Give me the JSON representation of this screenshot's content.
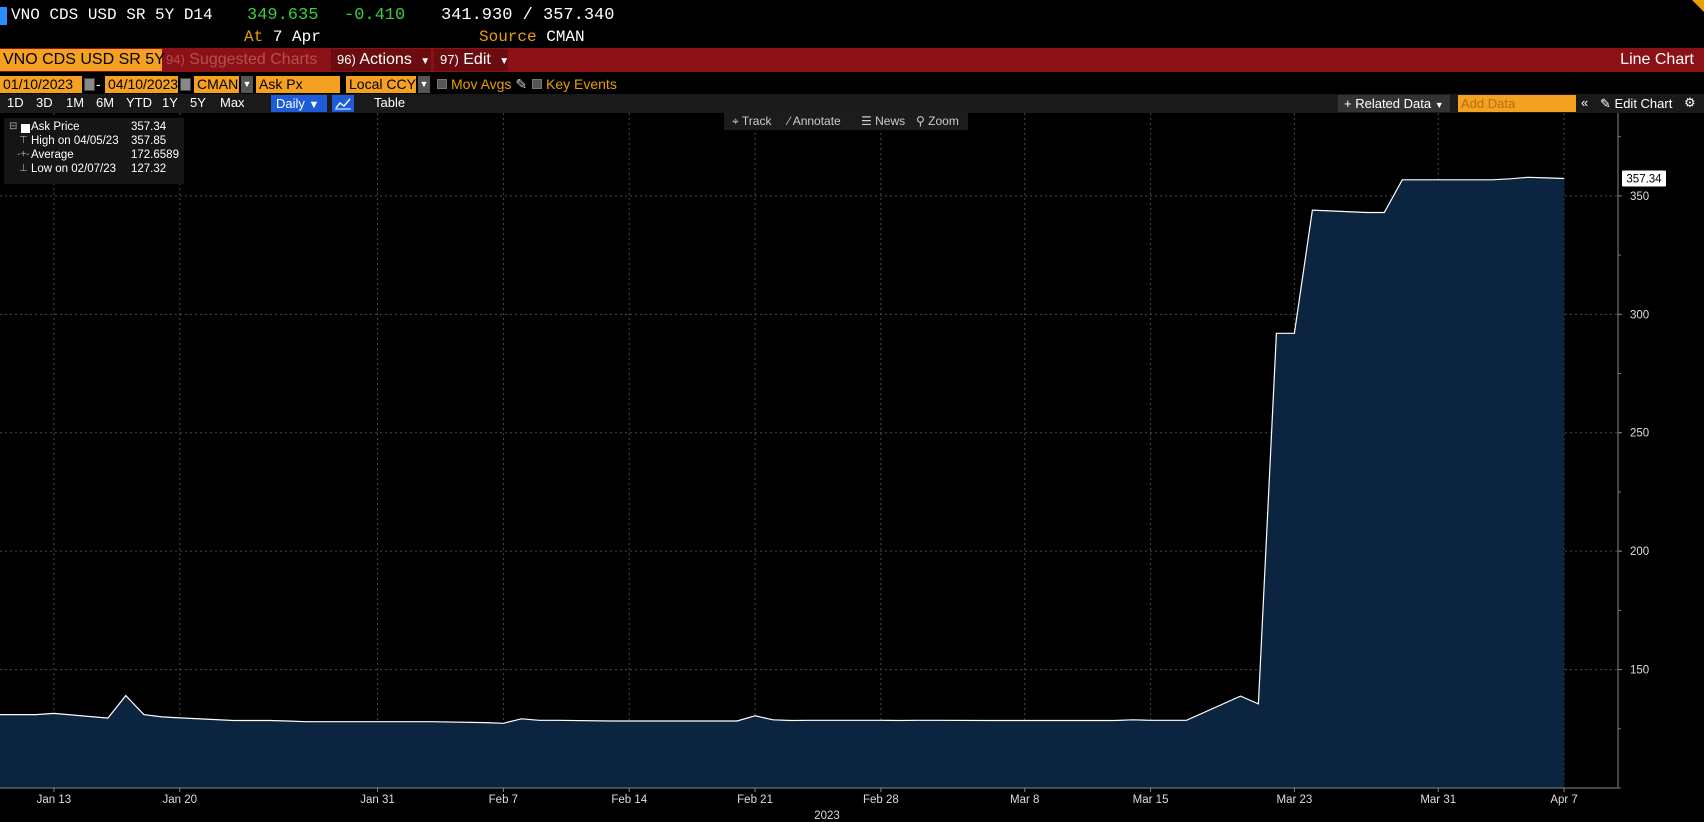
{
  "header": {
    "ticker": "VNO CDS USD SR 5Y D14",
    "last_price": "349.635",
    "net_change": "-0.410",
    "bid_ask": "341.930 / 357.340",
    "at_label": "At",
    "at_value": "7 Apr",
    "source_label": "Source",
    "source_value": "CMAN"
  },
  "toolbar": {
    "security": "VNO CDS USD SR 5Y",
    "suggested_num": "94)",
    "suggested_label": "Suggested Charts",
    "actions_num": "96)",
    "actions_label": "Actions",
    "edit_num": "97)",
    "edit_label": "Edit",
    "chart_type": "Line Chart"
  },
  "params": {
    "start_date": "01/10/2023",
    "dash": "-",
    "end_date": "04/10/2023",
    "source": "CMAN",
    "field": "Ask Px",
    "currency": "Local CCY",
    "mov_avgs": "Mov Avgs",
    "key_events": "Key Events"
  },
  "range": {
    "buttons": [
      "1D",
      "3D",
      "1M",
      "6M",
      "YTD",
      "1Y",
      "5Y",
      "Max"
    ],
    "frequency": "Daily",
    "table_label": "Table",
    "related_data": "+ Related Data",
    "add_data": "Add Data",
    "collapse": "«",
    "edit_chart": "Edit Chart"
  },
  "chart_tools": {
    "track": "Track",
    "annotate": "Annotate",
    "news": "News",
    "zoom": "Zoom"
  },
  "legend": {
    "series_name": "Ask Price",
    "series_last": "357.34",
    "high_label": "High on 04/05/23",
    "high_value": "357.85",
    "avg_label": "Average",
    "avg_value": "172.6589",
    "low_label": "Low on 02/07/23",
    "low_value": "127.32"
  },
  "colors": {
    "accent_orange": "#f4a020",
    "function_bar_red": "#8c1116",
    "positive_green": "#3ccb3c",
    "area_fill": "#0b2440",
    "line": "#ffffff"
  },
  "chart_data": {
    "type": "area",
    "title": "",
    "xlabel": "2023",
    "ylabel": "",
    "ylim": [
      100,
      385
    ],
    "xlim": [
      "2023-01-10",
      "2023-04-10"
    ],
    "x_ticks": [
      "Jan 13",
      "Jan 20",
      "Jan 31",
      "Feb 7",
      "Feb 14",
      "Feb 21",
      "Feb 28",
      "Mar 8",
      "Mar 15",
      "Mar 23",
      "Mar 31",
      "Apr 7"
    ],
    "y_ticks": [
      150,
      200,
      250,
      300,
      350
    ],
    "last_value_label": "357.34",
    "grid": true,
    "series": [
      {
        "name": "Ask Price",
        "x": [
          "2023-01-10",
          "2023-01-11",
          "2023-01-12",
          "2023-01-13",
          "2023-01-16",
          "2023-01-17",
          "2023-01-18",
          "2023-01-19",
          "2023-01-20",
          "2023-01-23",
          "2023-01-24",
          "2023-01-25",
          "2023-01-26",
          "2023-01-27",
          "2023-01-30",
          "2023-01-31",
          "2023-02-01",
          "2023-02-02",
          "2023-02-03",
          "2023-02-06",
          "2023-02-07",
          "2023-02-08",
          "2023-02-09",
          "2023-02-10",
          "2023-02-13",
          "2023-02-14",
          "2023-02-15",
          "2023-02-16",
          "2023-02-17",
          "2023-02-20",
          "2023-02-21",
          "2023-02-22",
          "2023-02-23",
          "2023-02-24",
          "2023-02-27",
          "2023-02-28",
          "2023-03-01",
          "2023-03-02",
          "2023-03-03",
          "2023-03-06",
          "2023-03-07",
          "2023-03-08",
          "2023-03-09",
          "2023-03-10",
          "2023-03-13",
          "2023-03-14",
          "2023-03-15",
          "2023-03-16",
          "2023-03-17",
          "2023-03-20",
          "2023-03-21",
          "2023-03-22",
          "2023-03-23",
          "2023-03-24",
          "2023-03-27",
          "2023-03-28",
          "2023-03-29",
          "2023-03-30",
          "2023-03-31",
          "2023-04-03",
          "2023-04-04",
          "2023-04-05",
          "2023-04-06",
          "2023-04-07"
        ],
        "values": [
          131.0,
          131.0,
          131.0,
          131.5,
          129.5,
          139.0,
          131.0,
          130.0,
          129.6,
          128.5,
          128.5,
          128.5,
          128.3,
          128.0,
          128.0,
          128.0,
          128.0,
          128.0,
          128.0,
          127.6,
          127.32,
          129.2,
          128.6,
          128.6,
          128.3,
          128.3,
          128.3,
          128.3,
          128.3,
          128.3,
          130.5,
          128.8,
          128.5,
          128.6,
          128.6,
          128.6,
          128.5,
          128.6,
          128.6,
          128.5,
          128.5,
          128.5,
          128.5,
          128.5,
          128.5,
          128.8,
          128.6,
          128.6,
          128.6,
          138.8,
          135.5,
          292.0,
          292.0,
          344.0,
          343.0,
          343.0,
          356.8,
          356.8,
          356.8,
          356.8,
          357.2,
          357.85,
          357.6,
          357.34
        ]
      }
    ]
  }
}
